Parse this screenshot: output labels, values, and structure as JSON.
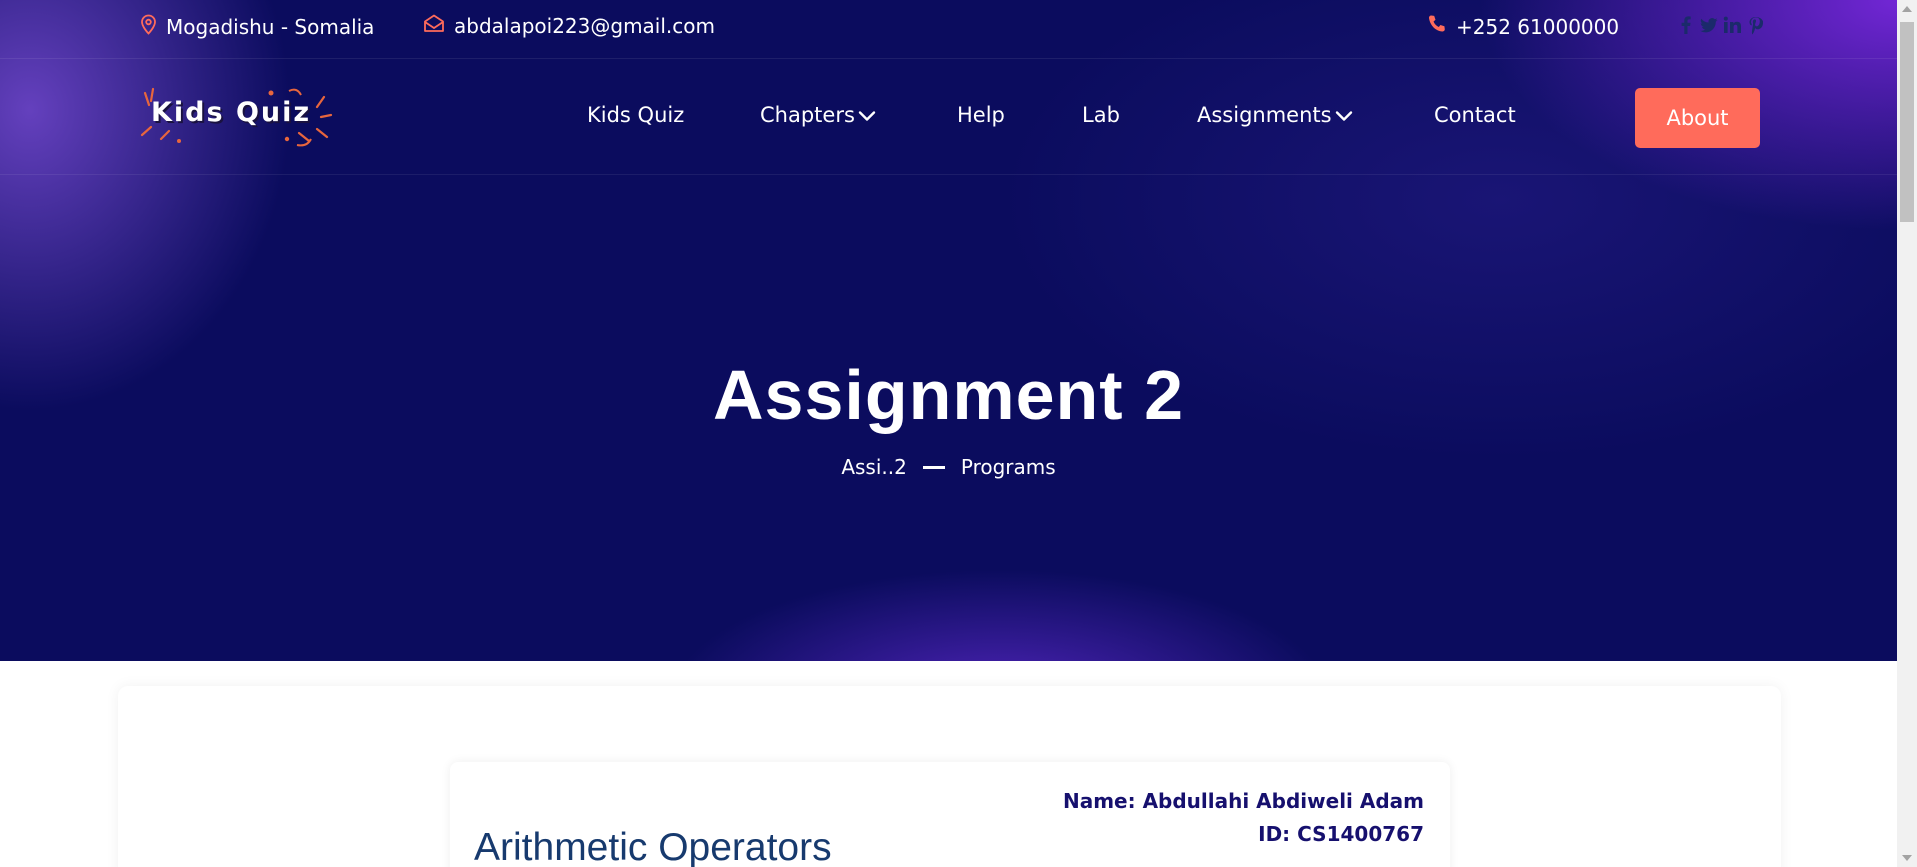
{
  "topbar": {
    "location": "Mogadishu - Somalia",
    "email": "abdalapoi223@gmail.com",
    "phone": "+252 61000000",
    "social_icons": [
      "facebook-icon",
      "twitter-icon",
      "linkedin-icon",
      "pinterest-icon"
    ]
  },
  "logo": {
    "text": "Kids Quiz"
  },
  "nav": {
    "items": [
      {
        "label": "Kids Quiz",
        "dropdown": false
      },
      {
        "label": "Chapters",
        "dropdown": true
      },
      {
        "label": "Help",
        "dropdown": false
      },
      {
        "label": "Lab",
        "dropdown": false
      },
      {
        "label": "Assignments",
        "dropdown": true
      },
      {
        "label": "Contact",
        "dropdown": false
      }
    ],
    "cta_label": "About"
  },
  "hero": {
    "title": "Assignment 2",
    "breadcrumb": [
      "Assi..2",
      "Programs"
    ]
  },
  "content": {
    "student_name": "Name: Abdullahi Abdiweli Adam",
    "student_id": "ID: CS1400767",
    "section_title": "Arithmetic Operators"
  },
  "colors": {
    "hero_bg": "#0b0c5e",
    "accent": "#ff6b5b",
    "heading_dark": "#16106e",
    "section_title": "#173a6e"
  }
}
